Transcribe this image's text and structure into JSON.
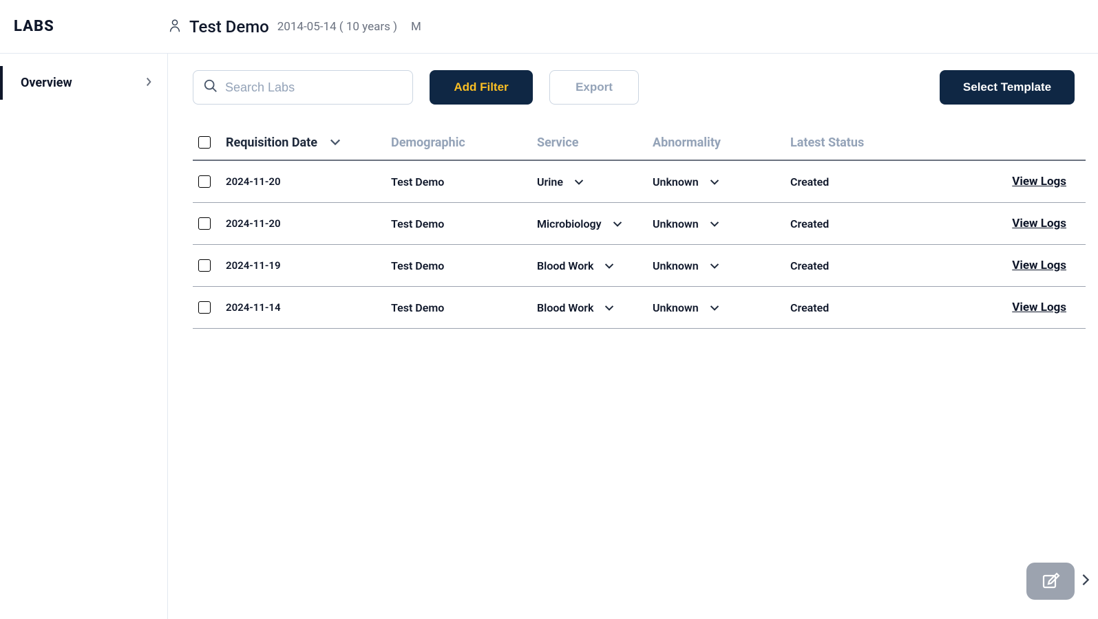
{
  "header": {
    "app_title": "LABS",
    "patient_name": "Test Demo",
    "patient_dob": "2014-05-14 ( 10 years )",
    "patient_gender": "M"
  },
  "sidebar": {
    "items": [
      {
        "label": "Overview"
      }
    ]
  },
  "toolbar": {
    "search_placeholder": "Search Labs",
    "add_filter_label": "Add Filter",
    "export_label": "Export",
    "select_template_label": "Select Template"
  },
  "table": {
    "headers": {
      "requisition_date": "Requisition Date",
      "demographic": "Demographic",
      "service": "Service",
      "abnormality": "Abnormality",
      "latest_status": "Latest Status"
    },
    "rows": [
      {
        "date": "2024-11-20",
        "demographic": "Test Demo",
        "service": "Urine",
        "abnormality": "Unknown",
        "status": "Created",
        "action": "View Logs"
      },
      {
        "date": "2024-11-20",
        "demographic": "Test Demo",
        "service": "Microbiology",
        "abnormality": "Unknown",
        "status": "Created",
        "action": "View Logs"
      },
      {
        "date": "2024-11-19",
        "demographic": "Test Demo",
        "service": "Blood Work",
        "abnormality": "Unknown",
        "status": "Created",
        "action": "View Logs"
      },
      {
        "date": "2024-11-14",
        "demographic": "Test Demo",
        "service": "Blood Work",
        "abnormality": "Unknown",
        "status": "Created",
        "action": "View Logs"
      }
    ]
  }
}
